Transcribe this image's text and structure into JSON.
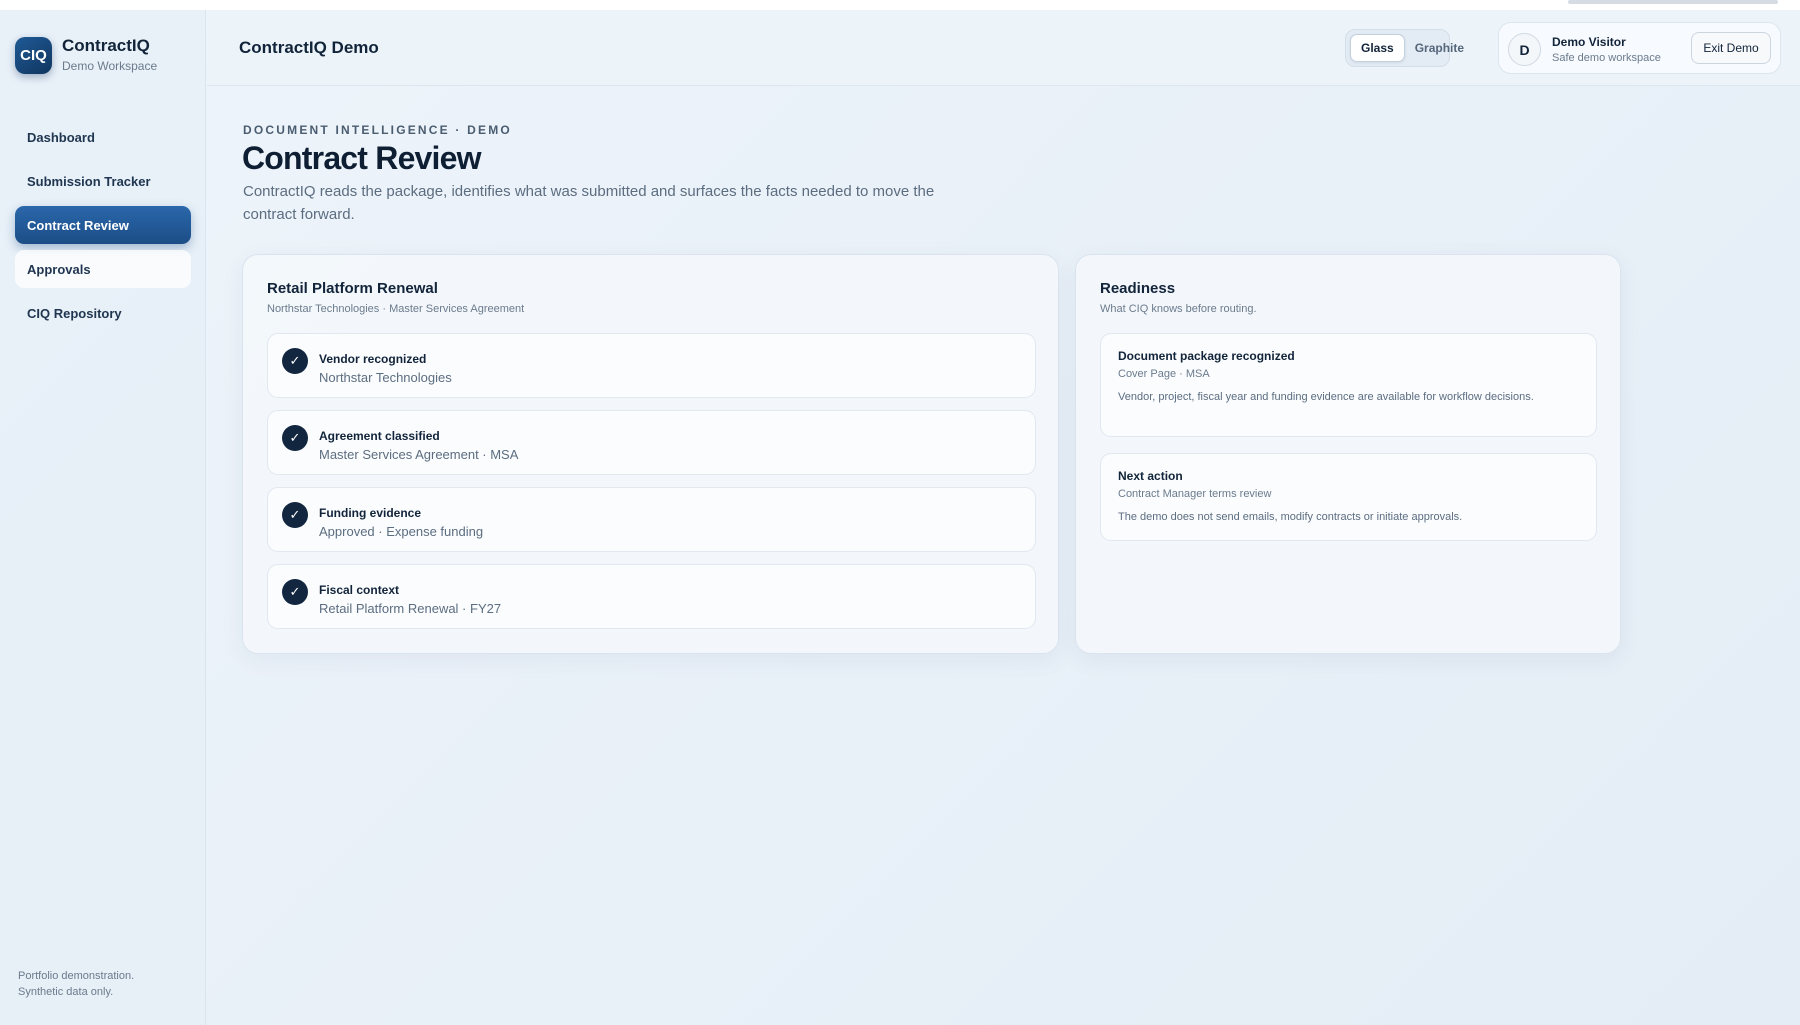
{
  "brand": {
    "logo_text": "CIQ",
    "name": "ContractIQ",
    "subtitle": "Demo Workspace"
  },
  "sidebar": {
    "items": [
      {
        "label": "Dashboard"
      },
      {
        "label": "Submission Tracker"
      },
      {
        "label": "Contract Review"
      },
      {
        "label": "Approvals"
      },
      {
        "label": "CIQ Repository"
      }
    ],
    "footnote_line1": "Portfolio demonstration.",
    "footnote_line2": "Synthetic data only."
  },
  "header": {
    "title": "ContractIQ Demo",
    "theme_options": [
      "Glass",
      "Graphite"
    ],
    "user": {
      "initial": "D",
      "name": "Demo Visitor",
      "subtitle": "Safe demo workspace"
    },
    "exit_label": "Exit Demo"
  },
  "main": {
    "eyebrow": "DOCUMENT INTELLIGENCE · DEMO",
    "title": "Contract Review",
    "description": "ContractIQ reads the package, identifies what was submitted and surfaces the facts needed to move the contract forward."
  },
  "contract_card": {
    "title": "Retail Platform Renewal",
    "subtitle": "Northstar Technologies · Master Services Agreement",
    "checks": [
      {
        "label": "Vendor recognized",
        "value": "Northstar Technologies"
      },
      {
        "label": "Agreement classified",
        "value": "Master Services Agreement · MSA"
      },
      {
        "label": "Funding evidence",
        "value": "Approved · Expense funding"
      },
      {
        "label": "Fiscal context",
        "value": "Retail Platform Renewal · FY27"
      }
    ]
  },
  "readiness_card": {
    "title": "Readiness",
    "subtitle": "What CIQ knows before routing.",
    "items": [
      {
        "title": "Document package recognized",
        "meta": "Cover Page · MSA",
        "body": "Vendor, project, fiscal year and funding evidence are available for workflow decisions."
      },
      {
        "title": "Next action",
        "meta": "Contract Manager terms review",
        "body": "The demo does not send emails, modify contracts or initiate approvals."
      }
    ]
  },
  "icons": {
    "check": "check-icon"
  },
  "colors": {
    "accent": "#1c4d86",
    "check_fill": "#12263f"
  }
}
